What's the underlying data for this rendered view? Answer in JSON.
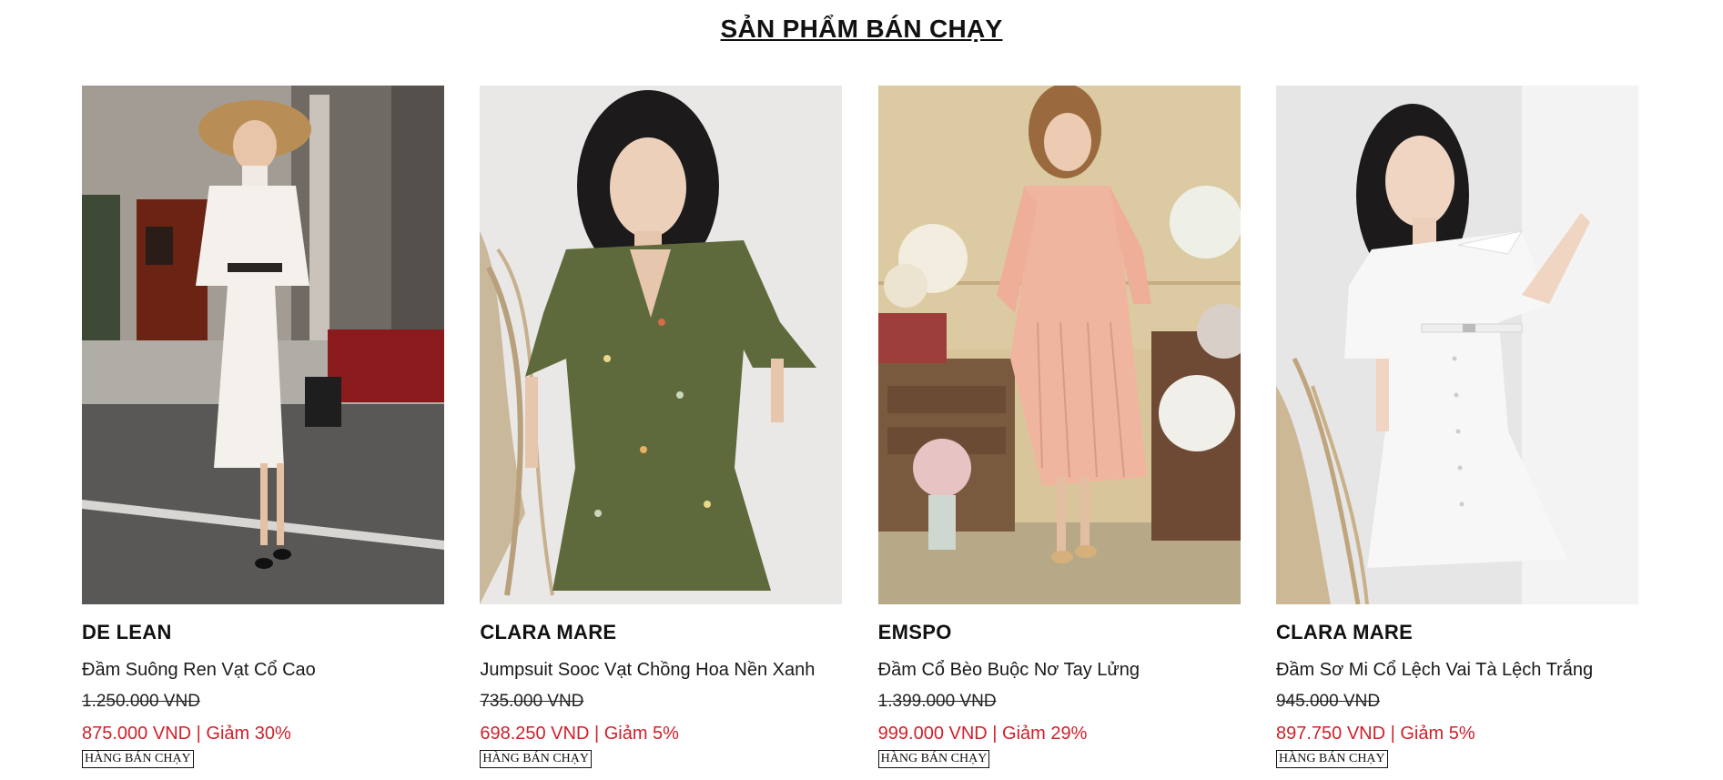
{
  "section": {
    "title": "SẢN PHẨM BÁN CHẠY"
  },
  "products": [
    {
      "brand": "DE LEAN",
      "name": "Đầm Suông Ren Vạt Cổ Cao",
      "old_price": "1.250.000 VND",
      "sale_price": "875.000 VND",
      "separator": " | ",
      "discount": "Giảm 30%",
      "badge": "HÀNG BÁN CHẠY",
      "image": "woman-white-lace-dress-straw-hat"
    },
    {
      "brand": "CLARA MARE",
      "name": "Jumpsuit Sooc Vạt Chồng Hoa Nền Xanh",
      "old_price": "735.000 VND",
      "sale_price": "698.250 VND",
      "separator": " | ",
      "discount": "Giảm 5%",
      "badge": "HÀNG BÁN CHẠY",
      "image": "woman-green-floral-jumpsuit"
    },
    {
      "brand": "EMSPO",
      "name": "Đầm Cổ Bèo Buộc Nơ Tay Lửng",
      "old_price": "1.399.000 VND",
      "sale_price": "999.000 VND",
      "separator": " | ",
      "discount": "Giảm 29%",
      "badge": "HÀNG BÁN CHẠY",
      "image": "woman-pink-floral-pleated-dress"
    },
    {
      "brand": "CLARA MARE",
      "name": "Đầm Sơ Mi Cổ Lệch Vai Tà Lệch Trắng",
      "old_price": "945.000 VND",
      "sale_price": "897.750 VND",
      "separator": " | ",
      "discount": "Giảm 5%",
      "badge": "HÀNG BÁN CHẠY",
      "image": "woman-white-off-shoulder-shirt-dress"
    }
  ],
  "colors": {
    "sale": "#d0202b",
    "text": "#111111"
  }
}
